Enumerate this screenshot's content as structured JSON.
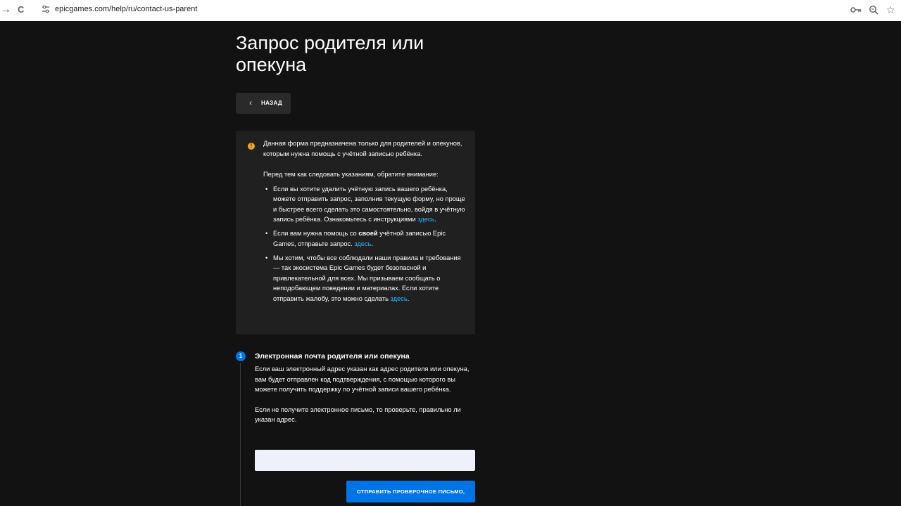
{
  "browser": {
    "back_glyph": "→",
    "reload_glyph": "C",
    "url": "epicgames.com/help/ru/contact-us-parent",
    "right_icons": [
      "key-icon",
      "zoom-icon",
      "star-icon"
    ]
  },
  "page": {
    "title": "Запрос родителя или опекуна",
    "back_label": "НАЗАД",
    "notice": {
      "icon": "!",
      "intro": "Данная форма предназначена только для родителей и опекунов, которым нужна помощь с учётной записью ребёнка.",
      "before": "Перед тем как следовать указаниям, обратите внимание:",
      "bullets": [
        {
          "text": "Если вы хотите удалить учётную запись вашего ребёнка, можете отправить запрос, заполнив текущую форму, но проще и быстрее всего сделать это самостоятельно, войдя в учётную запись ребёнка. Ознакомьтесь с инструкциями ",
          "link": "здесь",
          "end": "."
        },
        {
          "pre": "Если вам нужна помощь со ",
          "bold": "своей",
          "post": " учётной записью Epic Games, отправьте запрос. ",
          "link": "здесь",
          "end": "."
        },
        {
          "text": "Мы хотим, чтобы все соблюдали наши правила и требования — так экосистема Epic Games будет безопасной и привлекательной для всех. Мы призываем сообщать о неподобающем поведении и материалах. Если хотите отправить жалобу, это можно сделать ",
          "link": "здесь",
          "end": "."
        }
      ]
    },
    "step": {
      "number": "1",
      "title": "Электронная почта родителя или опекуна",
      "desc1": "Если ваш электронный адрес указан как адрес родителя или опекуна, вам будет отправлен код подтверждения, с помощью которого вы можете получить поддержку по учётной записи вашего ребёнка.",
      "desc2": "Если не получите электронное письмо, то проверьте, правильно ли указан адрес.",
      "email_value": "",
      "send_label": "ОТПРАВИТЬ ПРОВЕРОЧНОЕ ПИСЬМО,"
    }
  },
  "colors": {
    "background": "#121212",
    "notice_bg": "#202020",
    "accent": "#0074e4",
    "link": "#26bbff",
    "warning": "#f5a623"
  }
}
